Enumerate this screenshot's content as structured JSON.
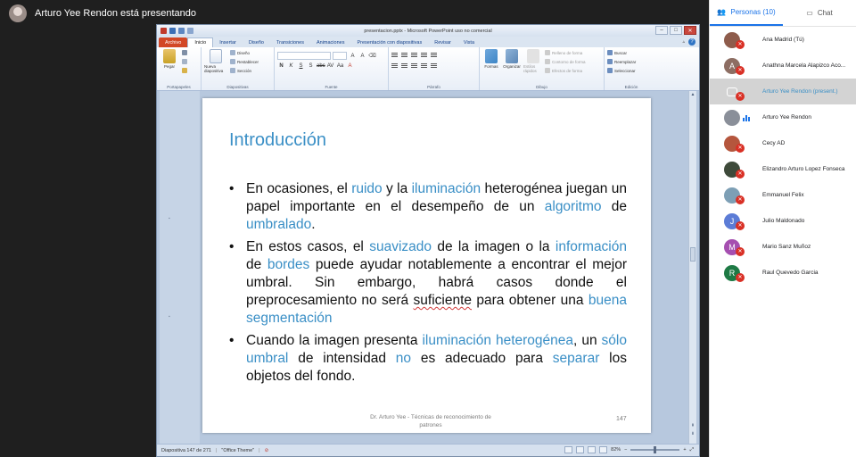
{
  "presenter_banner": "Arturo Yee Rendon está presentando",
  "panel": {
    "tabs": [
      {
        "label": "Personas (10)",
        "icon": "people-icon"
      },
      {
        "label": "Chat",
        "icon": "chat-icon"
      }
    ],
    "participants": [
      {
        "name": "Ana Madrid (Tú)",
        "avatar_color": "#8e5c4c",
        "initial": "",
        "muted": true
      },
      {
        "name": "Anathna Marcela Alapizco Aco...",
        "avatar_color": "#8d6e63",
        "initial": "A",
        "muted": true
      },
      {
        "name": "Arturo Yee Rendon (present.)",
        "avatar_color": "#555555",
        "initial": "",
        "muted": true,
        "presenting": true
      },
      {
        "name": "Arturo Yee Rendon",
        "avatar_color": "#8a8f99",
        "initial": "",
        "muted": false,
        "speaking": true
      },
      {
        "name": "Cecy AD",
        "avatar_color": "#b5563d",
        "initial": "",
        "muted": true
      },
      {
        "name": "Elizandro Arturo Lopez Fonseca",
        "avatar_color": "#3e4a3a",
        "initial": "",
        "muted": true
      },
      {
        "name": "Emmanuel Felix",
        "avatar_color": "#7d9fb5",
        "initial": "",
        "muted": true
      },
      {
        "name": "Julio Maldonado",
        "avatar_color": "#5c7cd6",
        "initial": "J",
        "muted": true
      },
      {
        "name": "Mario Sanz Muñoz",
        "avatar_color": "#a54fb0",
        "initial": "M",
        "muted": true
      },
      {
        "name": "Raul Quevedo Garcia",
        "avatar_color": "#1e7a45",
        "initial": "R",
        "muted": true
      }
    ]
  },
  "ppt": {
    "title": "presentacion.pptx - Microsoft PowerPoint uso no comercial",
    "tabs": [
      "Archivo",
      "Inicio",
      "Insertar",
      "Diseño",
      "Transiciones",
      "Animaciones",
      "Presentación con diapositivas",
      "Revisar",
      "Vista"
    ],
    "active_tab": "Inicio",
    "groups": {
      "portapapeles": {
        "label": "Portapapeles",
        "paste": "Pegar"
      },
      "diapositivas": {
        "label": "Diapositivas",
        "new_slide": "Nueva diapositiva",
        "layout": "Diseño",
        "reset": "Restablecer",
        "section": "Sección"
      },
      "fuente": {
        "label": "Fuente"
      },
      "parrafo": {
        "label": "Párrafo"
      },
      "dibujo": {
        "label": "Dibujo",
        "shapes": "Formas",
        "arrange": "Organizar",
        "quick_styles": "Estilos rápidos",
        "fill": "Relleno de forma",
        "outline": "Contorno de forma",
        "effects": "Efectos de forma"
      },
      "edicion": {
        "label": "Edición",
        "find": "Buscar",
        "replace": "Reemplazar",
        "select": "Seleccionar"
      }
    },
    "slide": {
      "title": "Introducción",
      "bullets": [
        [
          {
            "t": "En ocasiones, el ",
            "s": "n"
          },
          {
            "t": "ruido",
            "s": "h"
          },
          {
            "t": " y la ",
            "s": "n"
          },
          {
            "t": "iluminación",
            "s": "h"
          },
          {
            "t": " heterogénea juegan un papel importante  en el desempeño de un ",
            "s": "n"
          },
          {
            "t": "algoritmo",
            "s": "h"
          },
          {
            "t": " de ",
            "s": "n"
          },
          {
            "t": "umbralado",
            "s": "h"
          },
          {
            "t": ".",
            "s": "n"
          }
        ],
        [
          {
            "t": "En estos casos, el ",
            "s": "n"
          },
          {
            "t": "suavizado",
            "s": "h"
          },
          {
            "t": " de la imagen o la ",
            "s": "n"
          },
          {
            "t": "información",
            "s": "h"
          },
          {
            "t": " de ",
            "s": "n"
          },
          {
            "t": "bordes",
            "s": "h"
          },
          {
            "t": " puede  ayudar notablemente a encontrar el mejor umbral. Sin embargo, habrá casos donde el preprocesamiento no será ",
            "s": "n"
          },
          {
            "t": "suficiente",
            "s": "u"
          },
          {
            "t": " para obtener una ",
            "s": "n"
          },
          {
            "t": "buena segmentación",
            "s": "h"
          }
        ],
        [
          {
            "t": "Cuando la imagen presenta ",
            "s": "n"
          },
          {
            "t": "iluminación heterogénea",
            "s": "h"
          },
          {
            "t": ", un ",
            "s": "n"
          },
          {
            "t": "sólo umbral",
            "s": "h"
          },
          {
            "t": " de intensidad ",
            "s": "n"
          },
          {
            "t": "no",
            "s": "h"
          },
          {
            "t": " es adecuado para ",
            "s": "n"
          },
          {
            "t": "separar",
            "s": "h"
          },
          {
            "t": " los objetos  del fondo.",
            "s": "n"
          }
        ]
      ],
      "footer": "Dr. Arturo Yee - Técnicas de reconocimiento de patrones",
      "page_number": "147"
    },
    "status": {
      "slide_info": "Diapositiva 147 de 271",
      "theme": "\"Office Theme\"",
      "zoom": "82%"
    },
    "colors": {
      "accent_blue": "#3a8fc6",
      "file_tab": "#d24726"
    }
  }
}
